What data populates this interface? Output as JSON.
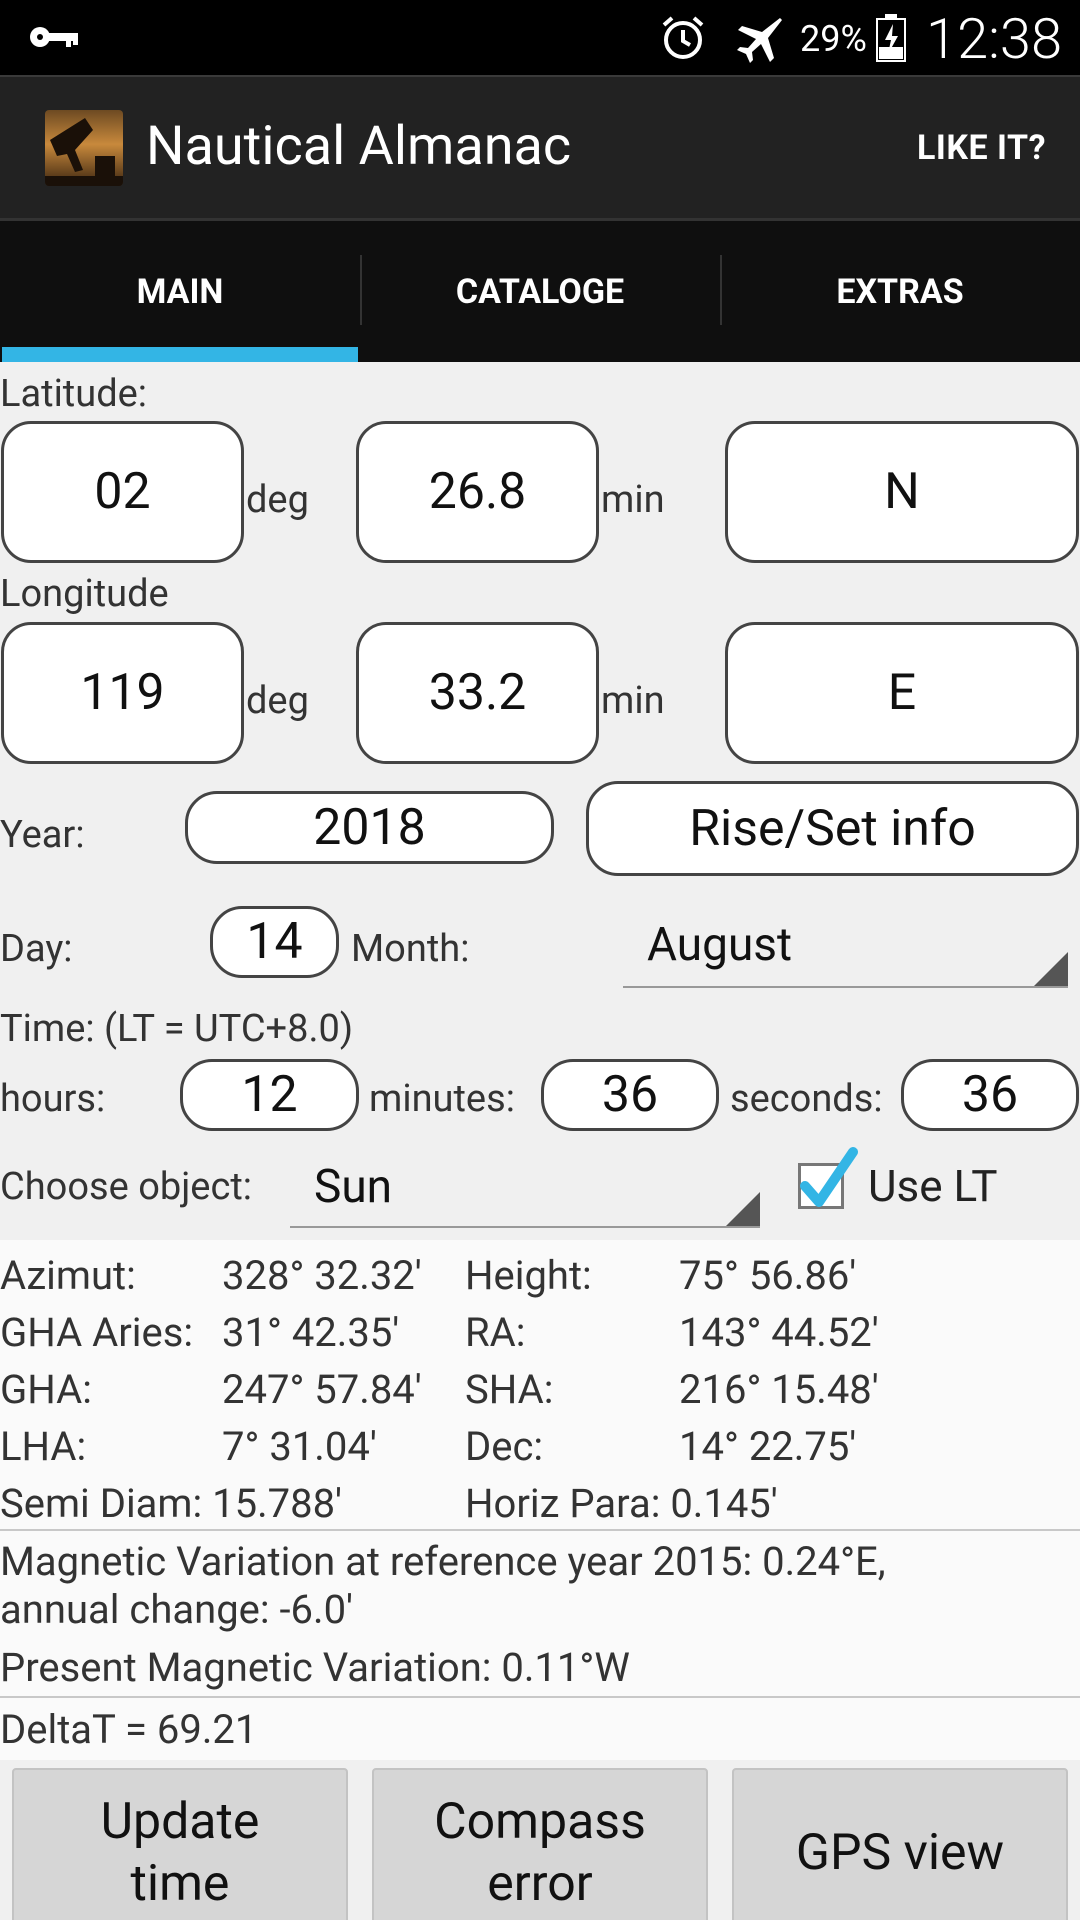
{
  "status_bar": {
    "battery_percent": "29%",
    "time": "12:38",
    "icons": [
      "key-icon",
      "alarm-icon",
      "airplane-mode-icon",
      "battery-icon"
    ]
  },
  "action_bar": {
    "title": "Nautical Almanac",
    "like_label": "LIKE IT?"
  },
  "tabs": [
    {
      "label": "MAIN",
      "active": true
    },
    {
      "label": "CATALOGE",
      "active": false
    },
    {
      "label": "EXTRAS",
      "active": false
    }
  ],
  "latitude": {
    "label": "Latitude:",
    "deg": "02",
    "deg_unit": "deg",
    "min": "26.8",
    "min_unit": "min",
    "hemisphere": "N"
  },
  "longitude": {
    "label": "Longitude",
    "deg": "119",
    "deg_unit": "deg",
    "min": "33.2",
    "min_unit": "min",
    "hemisphere": "E"
  },
  "year": {
    "label": "Year:",
    "value": "2018"
  },
  "rise_set_label": "Rise/Set info",
  "day": {
    "label": "Day:",
    "value": "14"
  },
  "month": {
    "label": "Month:",
    "value": "August"
  },
  "time": {
    "label": "Time: (LT = UTC+8.0)",
    "hours_label": "hours:",
    "hours": "12",
    "minutes_label": "minutes:",
    "minutes": "36",
    "seconds_label": "seconds:",
    "seconds": "36"
  },
  "object": {
    "label": "Choose object:",
    "value": "Sun"
  },
  "use_lt": {
    "label": "Use LT",
    "checked": true
  },
  "results": {
    "azimut_label": "Azimut:",
    "azimut": "328° 32.32'",
    "height_label": "Height:",
    "height": "75° 56.86'",
    "gha_aries_label": "GHA Aries:",
    "gha_aries": "31° 42.35'",
    "ra_label": "RA:",
    "ra": "143° 44.52'",
    "gha_label": "GHA:",
    "gha": "247° 57.84'",
    "sha_label": "SHA:",
    "sha": "216° 15.48'",
    "lha_label": "LHA:",
    "lha": "7° 31.04'",
    "dec_label": "Dec:",
    "dec": "14° 22.75'",
    "semi_diam": "Semi Diam: 15.788'",
    "horiz_para": "Horiz Para: 0.145'"
  },
  "magnetic": {
    "line1": "Magnetic Variation at reference year 2015: 0.24°E,",
    "line2": "annual change: -6.0'",
    "present": "Present Magnetic Variation: 0.11°W"
  },
  "delta_t": "DeltaT = 69.21",
  "buttons": {
    "update_line1": "Update",
    "update_line2": "time",
    "compass_line1": "Compass",
    "compass_line2": "error",
    "gps": "GPS view"
  }
}
